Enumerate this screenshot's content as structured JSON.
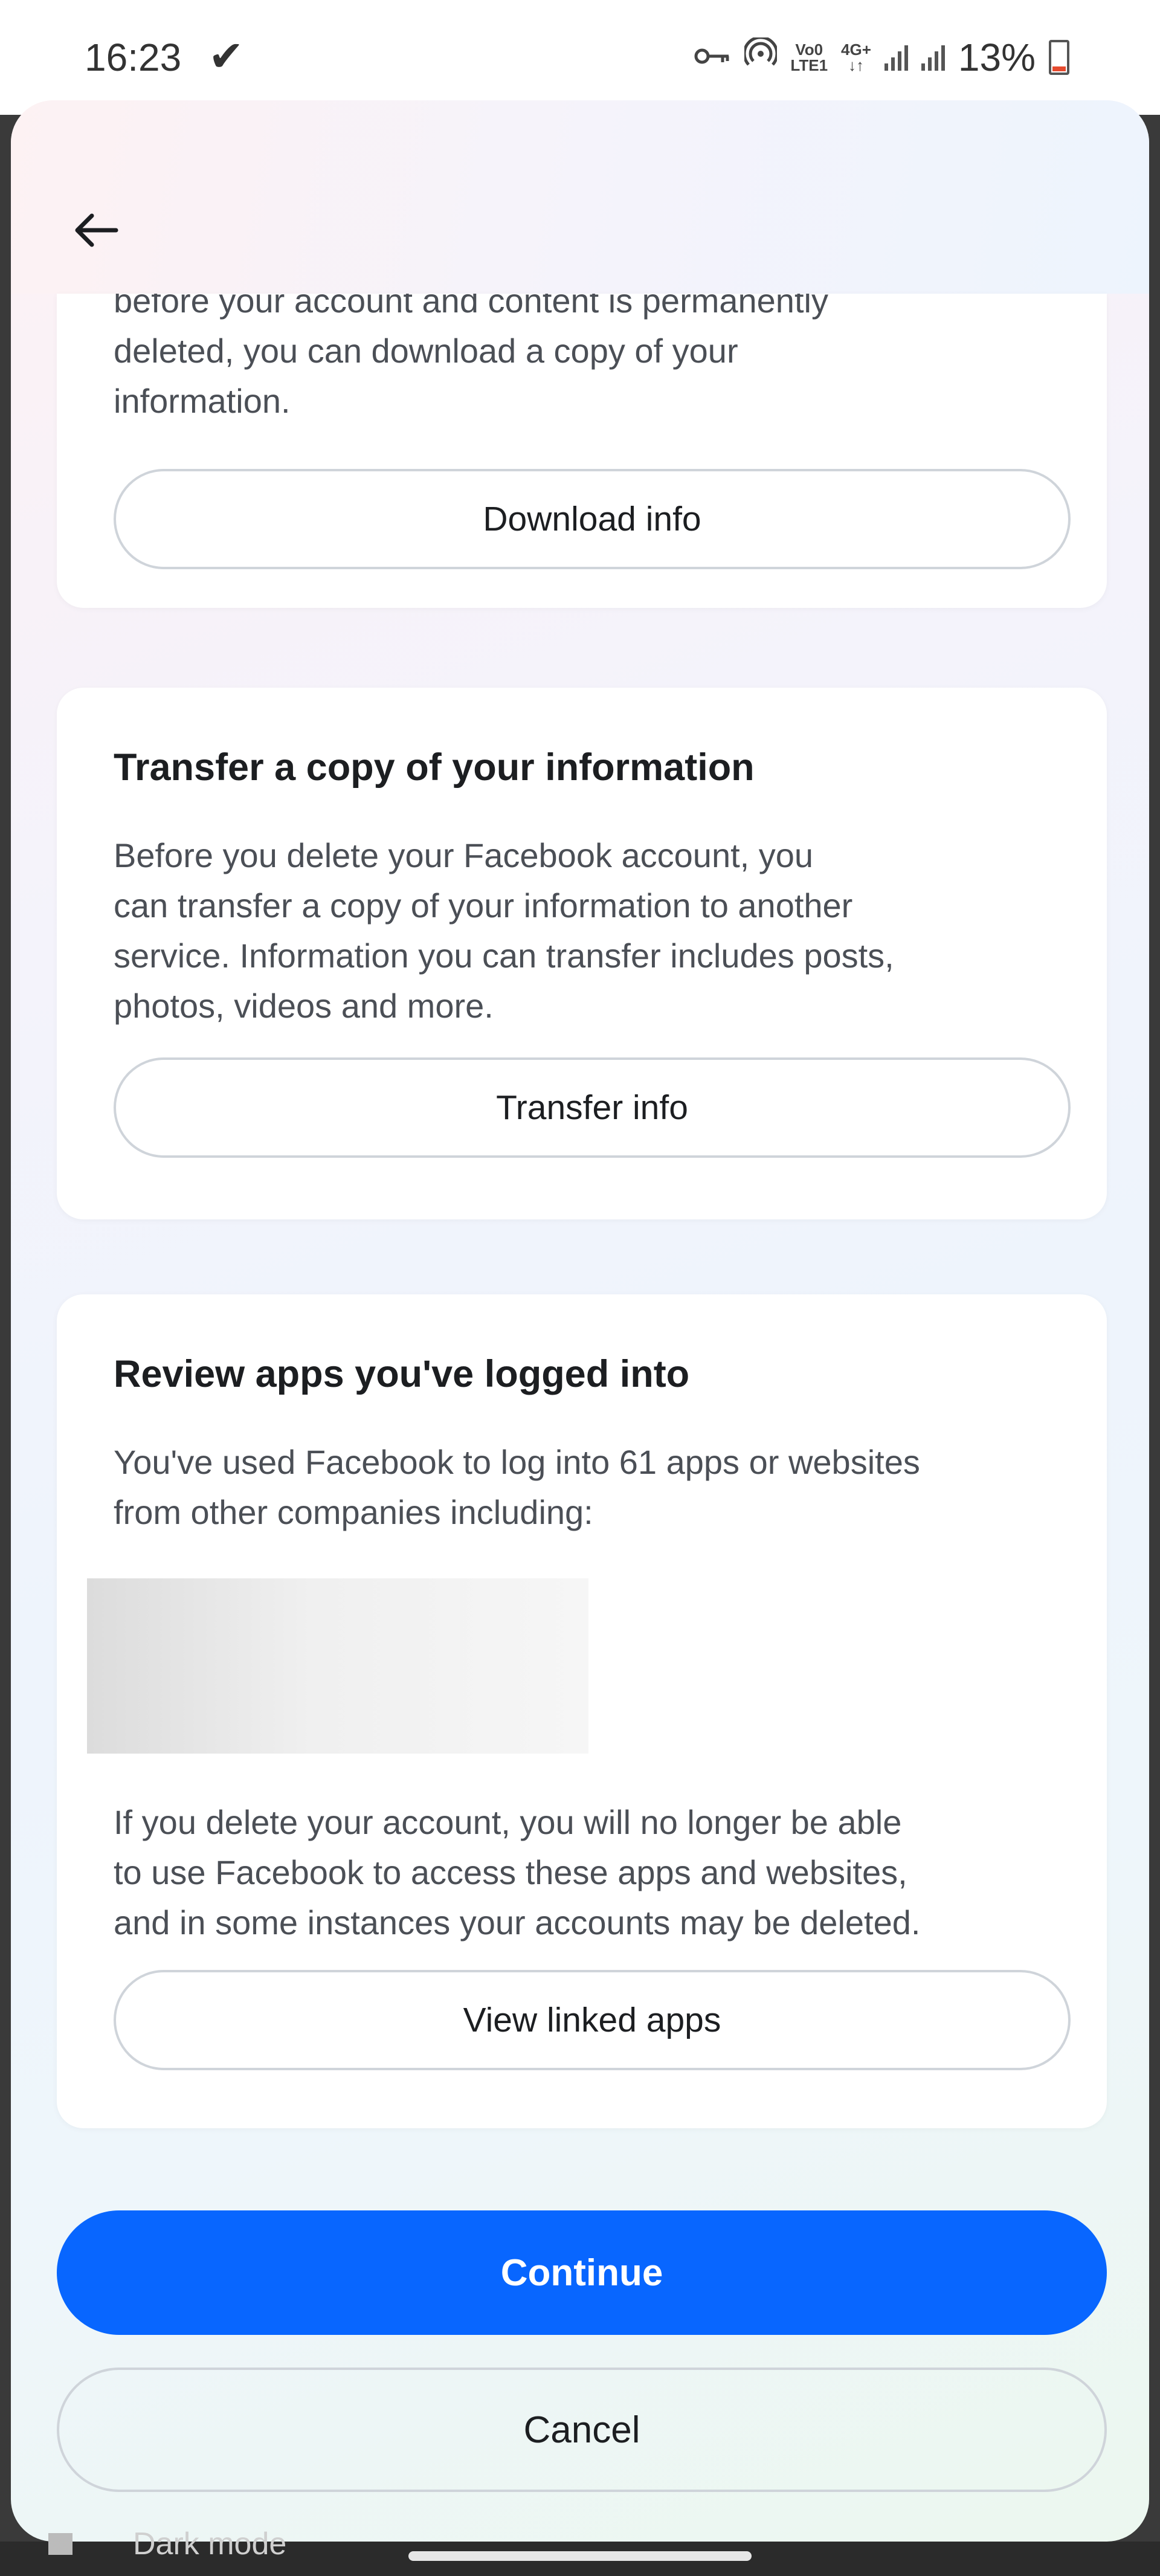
{
  "status_bar": {
    "time": "16:23",
    "check_mark": "✔",
    "net_label_top": "Vo0",
    "net_label_bottom": "LTE1",
    "net2_label_top": "4G+",
    "net2_label_bottom": "↓↑",
    "battery_pct": "13%",
    "battery_level": 0.13
  },
  "header": {
    "back_icon": "arrow-left-icon"
  },
  "download_card": {
    "text_line1": "before your account and content is permanently",
    "text_line2": "deleted, you can download a copy of your",
    "text_line3": "information.",
    "button_label": "Download info"
  },
  "transfer_card": {
    "title": "Transfer a copy of your information",
    "text_line1": "Before you delete your Facebook account, you",
    "text_line2": "can transfer a copy of your information to another",
    "text_line3": "service. Information you can transfer includes posts,",
    "text_line4": "photos, videos and more.",
    "button_label": "Transfer info"
  },
  "apps_card": {
    "title": "Review apps you've logged into",
    "text_line1": "You've used Facebook to log into 61 apps or websites",
    "text_line2": "from other companies including:",
    "warning_line1": "If you delete your account, you will no longer be able",
    "warning_line2": "to use Facebook to access these apps and websites,",
    "warning_line3": "and in some instances your accounts may be deleted.",
    "button_label": "View linked apps"
  },
  "actions": {
    "continue_label": "Continue",
    "cancel_label": "Cancel",
    "primary_color": "#0866ff"
  },
  "background_app": {
    "partial_text": "Dark mode"
  }
}
